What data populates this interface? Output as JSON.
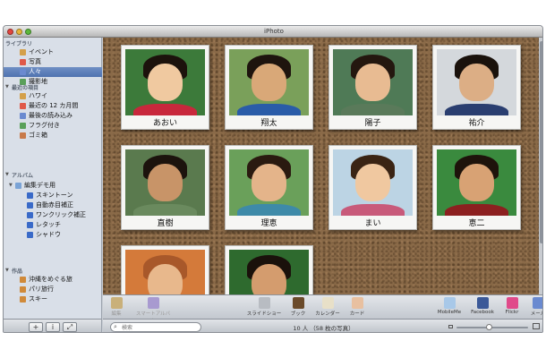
{
  "window": {
    "title": "iPhoto"
  },
  "sidebar": {
    "library_header": "ライブラリ",
    "library": [
      {
        "label": "イベント",
        "icon": "events-icon"
      },
      {
        "label": "写真",
        "icon": "photos-icon"
      },
      {
        "label": "人々",
        "icon": "faces-icon",
        "selected": true
      },
      {
        "label": "撮影地",
        "icon": "places-icon"
      }
    ],
    "recent_header": "最近の項目",
    "recent": [
      {
        "label": "ハワイ",
        "icon": "event-icon"
      },
      {
        "label": "最近の 12 カ月間",
        "icon": "calendar-icon"
      },
      {
        "label": "最後の読み込み",
        "icon": "import-icon"
      },
      {
        "label": "フラグ付き",
        "icon": "flag-icon"
      },
      {
        "label": "ゴミ箱",
        "icon": "trash-icon"
      }
    ],
    "albums_header": "アルバム",
    "albums_folder": "編集デモ用",
    "albums": [
      {
        "label": "スキントーン"
      },
      {
        "label": "自動赤目補正"
      },
      {
        "label": "ワンクリック補正"
      },
      {
        "label": "レタッチ"
      },
      {
        "label": "シャドウ"
      }
    ],
    "projects_header": "作品",
    "projects": [
      {
        "label": "沖縄をめぐる旅"
      },
      {
        "label": "パリ旅行"
      },
      {
        "label": "スキー"
      }
    ]
  },
  "faces": [
    {
      "name": "あおい",
      "bg": "#3c7a3a",
      "skin": "#f0c9a0",
      "hair": "#1c120c",
      "shirt": "#c8283c"
    },
    {
      "name": "翔太",
      "bg": "#7aa05a",
      "skin": "#d9a878",
      "hair": "#1e140e",
      "shirt": "#2a5ca8"
    },
    {
      "name": "陽子",
      "bg": "#4f7a56",
      "skin": "#e8bb92",
      "hair": "#24170f",
      "shirt": "#5a7a5a"
    },
    {
      "name": "祐介",
      "bg": "#d4d8dc",
      "skin": "#dcae85",
      "hair": "#1a120c",
      "shirt": "#2a3e70"
    },
    {
      "name": "直樹",
      "bg": "#5a7a4e",
      "skin": "#c89468",
      "hair": "#1c130d",
      "shirt": "#6a8a5e"
    },
    {
      "name": "理恵",
      "bg": "#6aa05a",
      "skin": "#e4b48a",
      "hair": "#2a1a10",
      "shirt": "#3e8aa8"
    },
    {
      "name": "まい",
      "bg": "#bcd4e4",
      "skin": "#f0c8a0",
      "hair": "#3a2414",
      "shirt": "#c85a7a"
    },
    {
      "name": "恵二",
      "bg": "#3a8a3e",
      "skin": "#d8a274",
      "hair": "#1e130b",
      "shirt": "#8c2020"
    },
    {
      "name": "",
      "bg": "#d47a3a",
      "skin": "#e8b88c",
      "hair": "#a8582a",
      "shirt": "#d49058"
    },
    {
      "name": "",
      "bg": "#2e6a2e",
      "skin": "#d49c6e",
      "hair": "#1a110b",
      "shirt": "#4a4a4a"
    }
  ],
  "toolbar": {
    "left": [
      {
        "label": "編集",
        "icon": "edit-icon"
      },
      {
        "label": "スマートアルバム",
        "icon": "smart-album-icon"
      }
    ],
    "center": [
      {
        "label": "スライドショー",
        "icon": "slideshow-icon"
      },
      {
        "label": "ブック",
        "icon": "book-icon"
      },
      {
        "label": "カレンダー",
        "icon": "calendar-icon"
      },
      {
        "label": "カード",
        "icon": "card-icon"
      }
    ],
    "right": [
      {
        "label": "MobileMe",
        "icon": "mobileme-icon"
      },
      {
        "label": "Facebook",
        "icon": "facebook-icon"
      },
      {
        "label": "Flickr",
        "icon": "flickr-icon"
      },
      {
        "label": "メール",
        "icon": "mail-icon"
      }
    ]
  },
  "statusbar": {
    "search_placeholder": "検索",
    "count": "10 人 （58 枚の写真）",
    "zoom": 0.45
  }
}
